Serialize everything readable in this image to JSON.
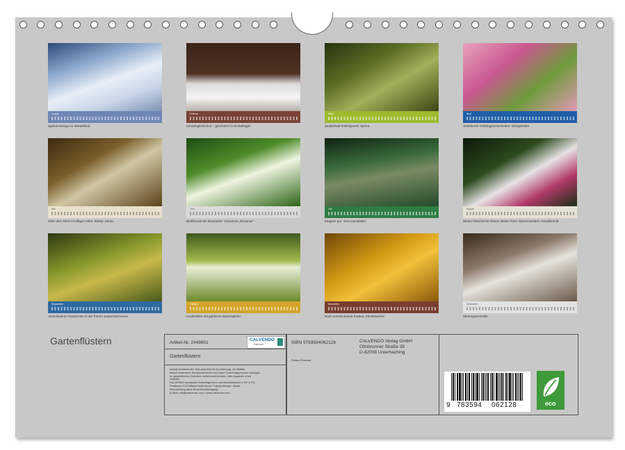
{
  "months": [
    {
      "month": "Januar",
      "caption": "Spireenzweige im Winterkleid",
      "strip": "#6e86b6",
      "photo": "linear-gradient(160deg,#2e4a78 0%,#8aa6cc 30%,#e8eef6 55%,#c8d6e8 75%,#7f93b3 100%)"
    },
    {
      "month": "Februar",
      "caption": "Schneeglöckchen – geschützt im Eichelhügel",
      "strip": "#7a4236",
      "photo": "linear-gradient(180deg,#3a2418 0%,#4e3224 45%,#dcdcdc 60%,#f4f4f4 80%,#b8b0a8 100%)"
    },
    {
      "month": "März",
      "caption": "Zauberhaft frühlingszart: Spirea",
      "strip": "#9dbb2e",
      "photo": "linear-gradient(150deg,#27330f 0%,#5b6d24 35%,#a2b05a 60%,#3a4714 100%)"
    },
    {
      "month": "April",
      "caption": "Strahlende Frühlingsschönheiten: Obstgehölze",
      "strip": "#1f5fa6",
      "photo": "linear-gradient(140deg,#e8a2bc 0%,#c85890 35%,#6f9a3c 65%,#e09ab4 100%)"
    },
    {
      "month": "Mai",
      "caption": "Über dem Teich in luftiger Höhe: Bobby James",
      "strip": "#e8e0cc",
      "photo": "linear-gradient(150deg,#3c2a10 0%,#7a5e2a 35%,#d0c6a4 55%,#5a4318 100%)"
    },
    {
      "month": "Juni",
      "caption": "Blühfreude bis November: Geranium „Rozanne\"",
      "strip": "#dadada",
      "photo": "linear-gradient(160deg,#1d4d12 0%,#4f8c2a 35%,#eef4e0 55%,#2e6418 100%)"
    },
    {
      "month": "Juli",
      "caption": "Eleganz pur: Seerosenblätter",
      "strip": "#2f7d44",
      "photo": "linear-gradient(170deg,#0f2412 0%,#3a6a3c 35%,#7a8a64 55%,#244a2a 100%)"
    },
    {
      "month": "August",
      "caption": "Blüten historischer Rosen leisten ihren Namensvettern Gesellschaft",
      "strip": "#e6e0d6",
      "photo": "linear-gradient(150deg,#0c1a0a 0%,#2c4a1e 35%,#e6e2e4 55%,#b23a6a 75%,#1a2e12 100%)"
    },
    {
      "month": "September",
      "caption": "Verschiedene Grassorten in der frühen Septembersonne",
      "strip": "#2e6aa0",
      "photo": "linear-gradient(160deg,#2c3a12 0%,#8a9a2c 40%,#c8b84a 60%,#4a5a1a 100%)"
    },
    {
      "month": "Oktober",
      "caption": "Lindenallee mit goldenen Baumspitzen",
      "strip": "#d4a52a",
      "photo": "linear-gradient(180deg,#3d5a1e 0%,#a2b84a 40%,#e8f0d8 50%,#6e8a2c 100%)"
    },
    {
      "month": "November",
      "caption": "Noch einmal warme Farben: Zierstraucher",
      "strip": "#7a3e30",
      "photo": "linear-gradient(150deg,#6e4808 0%,#d49a14 40%,#f2c03a 60%,#8a5a0a 100%)"
    },
    {
      "month": "Dezember",
      "caption": "Wintergartenstille",
      "strip": "#e2e2e2",
      "photo": "linear-gradient(160deg,#3a2a1c 0%,#8a7868 35%,#e6e2dc 55%,#6a5a48 100%)"
    }
  ],
  "calendar_title": "Gartenflüstern",
  "product": {
    "article": "Artikel-Nr. 2449651",
    "name": "Gartenflüstern",
    "logo": "CALVENDO",
    "logo_sub": "Kalender",
    "legal_lines": [
      "Infolge bestehender Schutzrechte ist es untersagt, die Blätter",
      "dieses Kalenders herauszutrennen und ohne Genehmigung des Verlages",
      "zu gewerblichen Zwecken weiterzuverwenden. Alle Angaben ohne",
      "Gewähr.",
      "CALVENDO produziert bedarfsgerecht und klimabewusst in DE & EU.",
      "Positivere CO2-Bilanz dank kurzer Transportwege. Abfall-",
      "Reduzierung dank Einzelstückfertigung.",
      "E-Mail: info@calvendo.com • www.calvendo.com"
    ],
    "isbn": "ISBN 9783594062128",
    "author": "Roland Rossner",
    "publisher_lines": [
      "CALVENDO Verlag GmbH",
      "Ottobrunner Straße 39",
      "D-82008 Unterhaching"
    ],
    "barcode_digits": [
      "9",
      "783594",
      "062128"
    ],
    "eco_label": "eco"
  }
}
